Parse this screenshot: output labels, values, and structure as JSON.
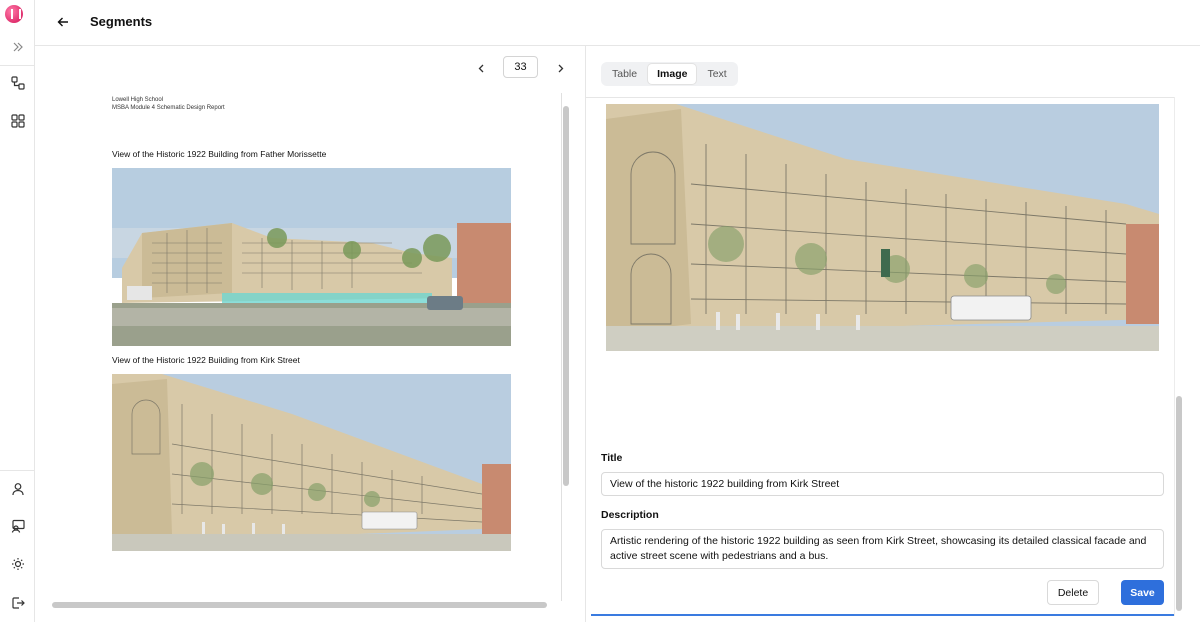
{
  "header": {
    "title": "Segments"
  },
  "sidebar": {
    "top_icons": [
      "app-logo-icon",
      "chevrons-right-icon",
      "workflow-icon",
      "grid-icon"
    ],
    "bottom_icons": [
      "user-icon",
      "presentation-icon",
      "sun-icon",
      "logout-icon"
    ]
  },
  "pager": {
    "page": "33"
  },
  "document": {
    "header_line1": "Lowell High School",
    "header_line2": "MSBA Module 4 Schematic Design Report",
    "caption1": "View of the Historic 1922 Building from Father Morissette",
    "caption2": "View of the Historic 1922 Building from Kirk Street"
  },
  "tabs": [
    "Table",
    "Image",
    "Text"
  ],
  "active_tab": "Image",
  "form": {
    "title_label": "Title",
    "title_value": "View of the historic 1922 building from Kirk Street",
    "description_label": "Description",
    "description_value": "Artistic rendering of the historic 1922 building as seen from Kirk Street, showcasing its detailed classical facade and active street scene with pedestrians and a bus.",
    "delete_label": "Delete",
    "save_label": "Save"
  },
  "colors": {
    "accent": "#2e6fdc",
    "brand": "#e0306e",
    "building": "#d8c9a8",
    "sky": "#a8c4dc"
  }
}
